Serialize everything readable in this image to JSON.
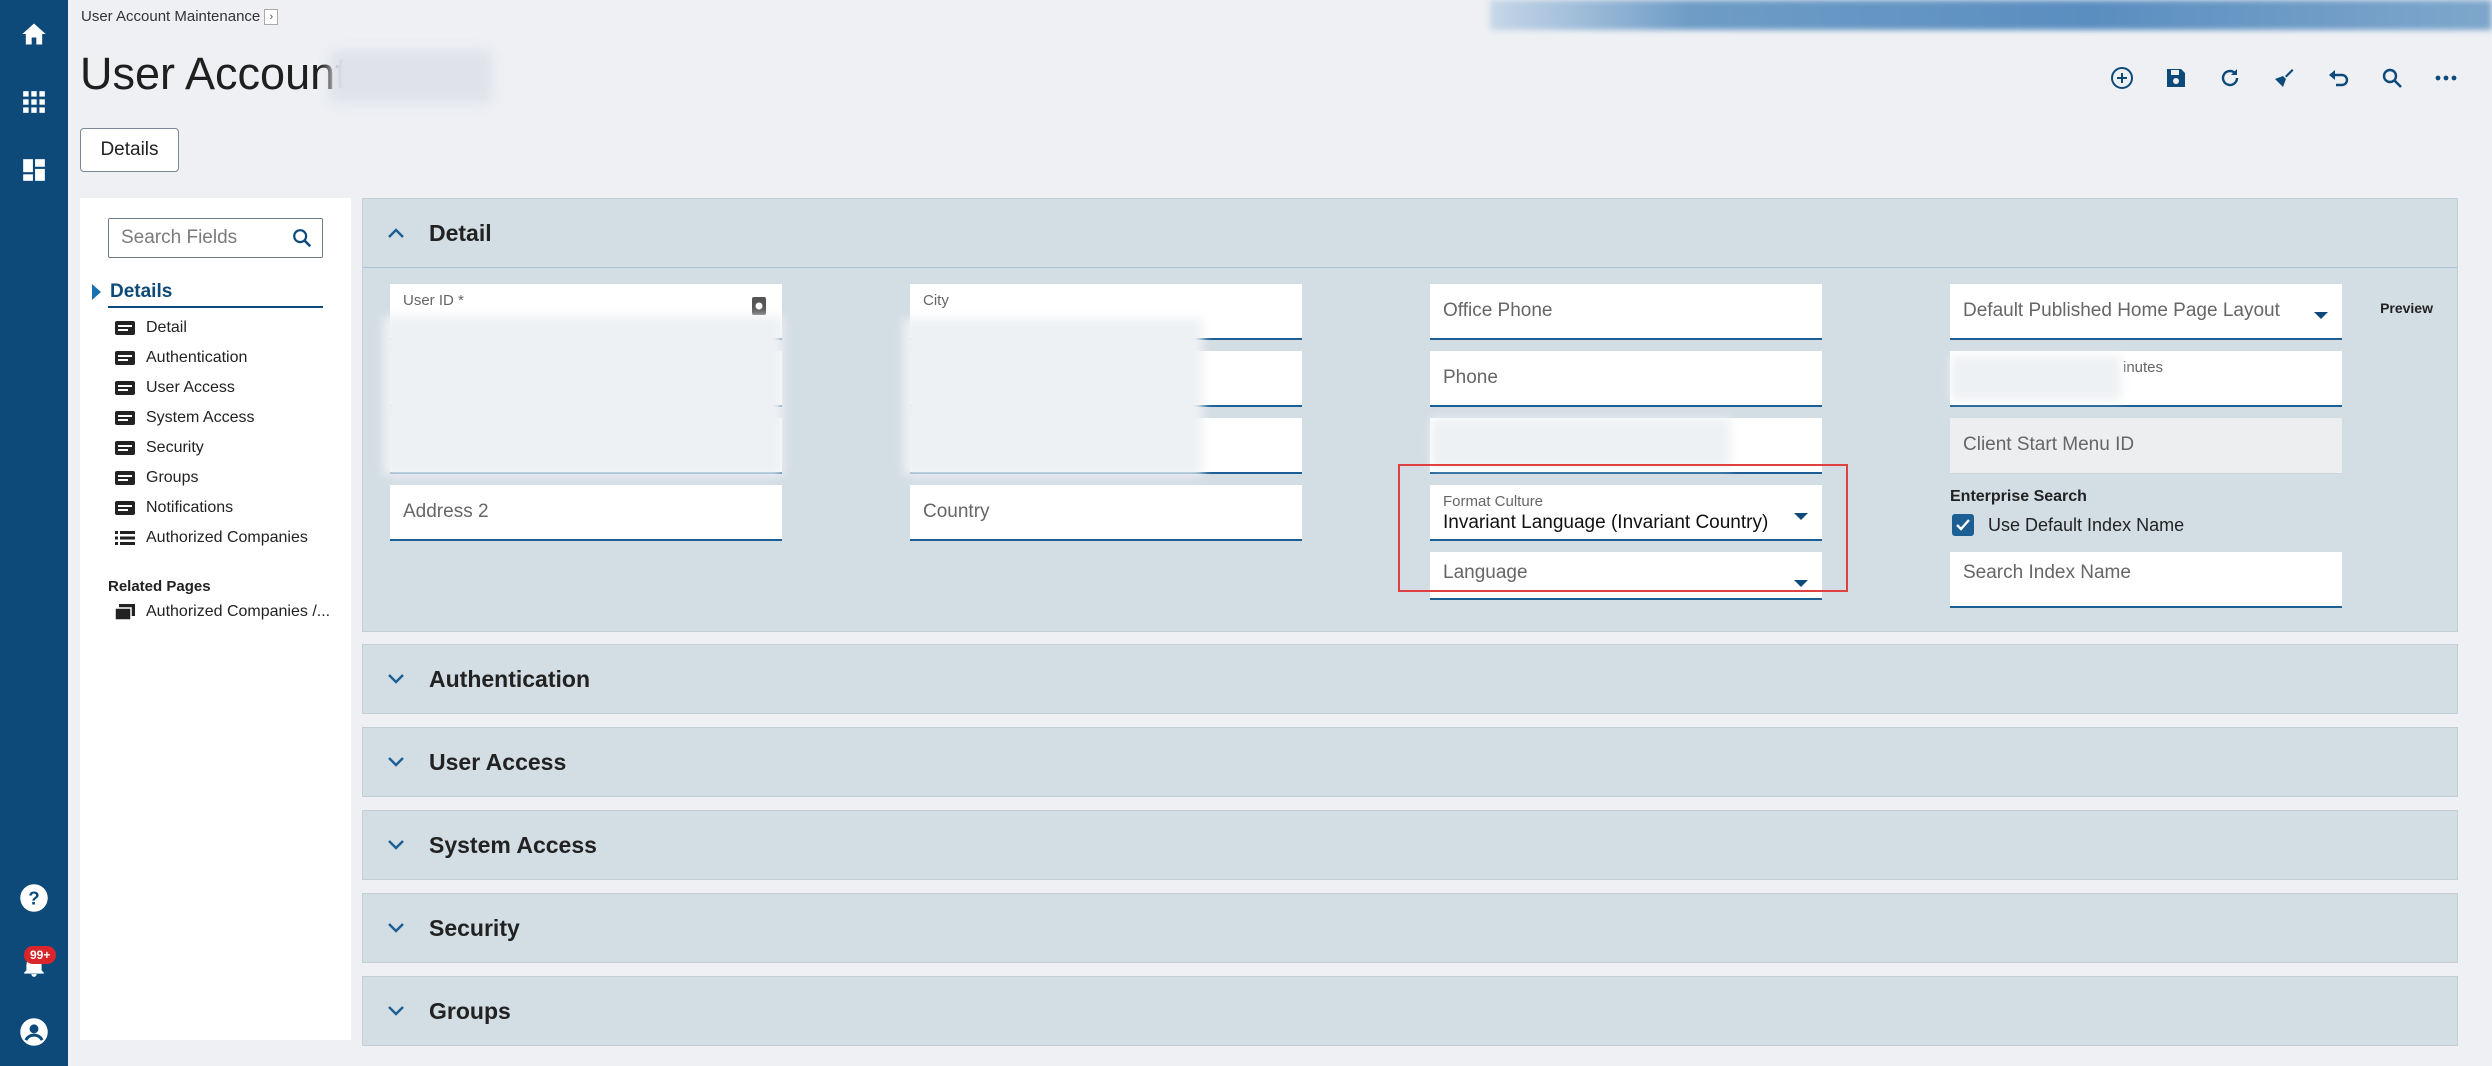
{
  "breadcrumb": {
    "label": "User Account Maintenance"
  },
  "page": {
    "title": "User Account"
  },
  "tabs": {
    "details": "Details"
  },
  "toolbar": {
    "icons": [
      "add-icon",
      "save-icon",
      "refresh-icon",
      "clear-icon",
      "undo-icon",
      "search-icon",
      "more-icon"
    ]
  },
  "rail": {
    "notification_badge": "99+"
  },
  "nav": {
    "search_placeholder": "Search Fields",
    "header": "Details",
    "items": [
      {
        "label": "Detail",
        "icon": "form-icon"
      },
      {
        "label": "Authentication",
        "icon": "form-icon"
      },
      {
        "label": "User Access",
        "icon": "form-icon"
      },
      {
        "label": "System Access",
        "icon": "form-icon"
      },
      {
        "label": "Security",
        "icon": "form-icon"
      },
      {
        "label": "Groups",
        "icon": "form-icon"
      },
      {
        "label": "Notifications",
        "icon": "form-icon"
      },
      {
        "label": "Authorized Companies",
        "icon": "list-icon"
      }
    ],
    "related_title": "Related Pages",
    "related_item": "Authorized Companies /..."
  },
  "detail": {
    "title": "Detail",
    "preview": "Preview",
    "fields": {
      "user_id": "User ID *",
      "city": "City",
      "address2": "Address 2",
      "country": "Country",
      "office_phone": "Office Phone",
      "phone": "Phone",
      "format_culture_label": "Format Culture",
      "format_culture_value": "Invariant Language (Invariant Country)",
      "language": "Language",
      "home_layout": "Default Published Home Page Layout",
      "minutes_suffix": "inutes",
      "client_start_menu": "Client Start Menu ID",
      "enterprise_search": "Enterprise Search",
      "use_default_index": "Use Default Index Name",
      "search_index_name": "Search Index Name"
    }
  },
  "sections": [
    "Authentication",
    "User Access",
    "System Access",
    "Security",
    "Groups"
  ],
  "colors": {
    "rail": "#0d4a7a",
    "section": "#d3dde4",
    "accent": "#1b5f94",
    "highlight": "#e04040"
  }
}
